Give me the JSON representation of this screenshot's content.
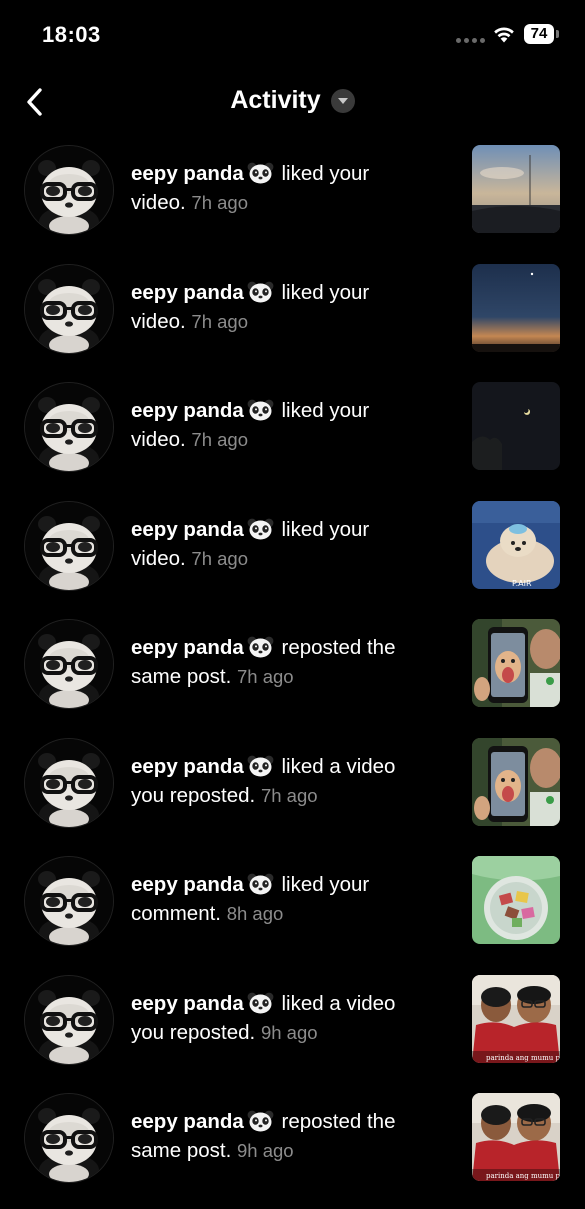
{
  "status": {
    "time": "18:03",
    "battery": "74"
  },
  "header": {
    "title": "Activity"
  },
  "items": [
    {
      "user": "eepy panda",
      "action": "liked your",
      "target": "video.",
      "time": "7h ago",
      "thumb": "thumb-sunset-car"
    },
    {
      "user": "eepy panda",
      "action": "liked your",
      "target": "video.",
      "time": "7h ago",
      "thumb": "thumb-dusk-sky"
    },
    {
      "user": "eepy panda",
      "action": "liked your",
      "target": "video.",
      "time": "7h ago",
      "thumb": "thumb-night-moon"
    },
    {
      "user": "eepy panda",
      "action": "liked your",
      "target": "video.",
      "time": "7h ago",
      "thumb": "thumb-fluffy-dog"
    },
    {
      "user": "eepy panda",
      "action": "reposted the",
      "target": "same post.",
      "time": "7h ago",
      "thumb": "thumb-dog-phone"
    },
    {
      "user": "eepy panda",
      "action": "liked a video",
      "target": "you reposted.",
      "time": "7h ago",
      "thumb": "thumb-dog-phone"
    },
    {
      "user": "eepy panda",
      "action": "liked your",
      "target": "comment.",
      "time": "8h ago",
      "thumb": "thumb-candy-plate"
    },
    {
      "user": "eepy panda",
      "action": "liked a video",
      "target": "you reposted.",
      "time": "9h ago",
      "thumb": "thumb-kids-red",
      "thumb_caption": "parinda ang mumu pa"
    },
    {
      "user": "eepy panda",
      "action": "reposted the",
      "target": "same post.",
      "time": "9h ago",
      "thumb": "thumb-kids-red",
      "thumb_caption": "parinda ang mumu pa"
    }
  ]
}
